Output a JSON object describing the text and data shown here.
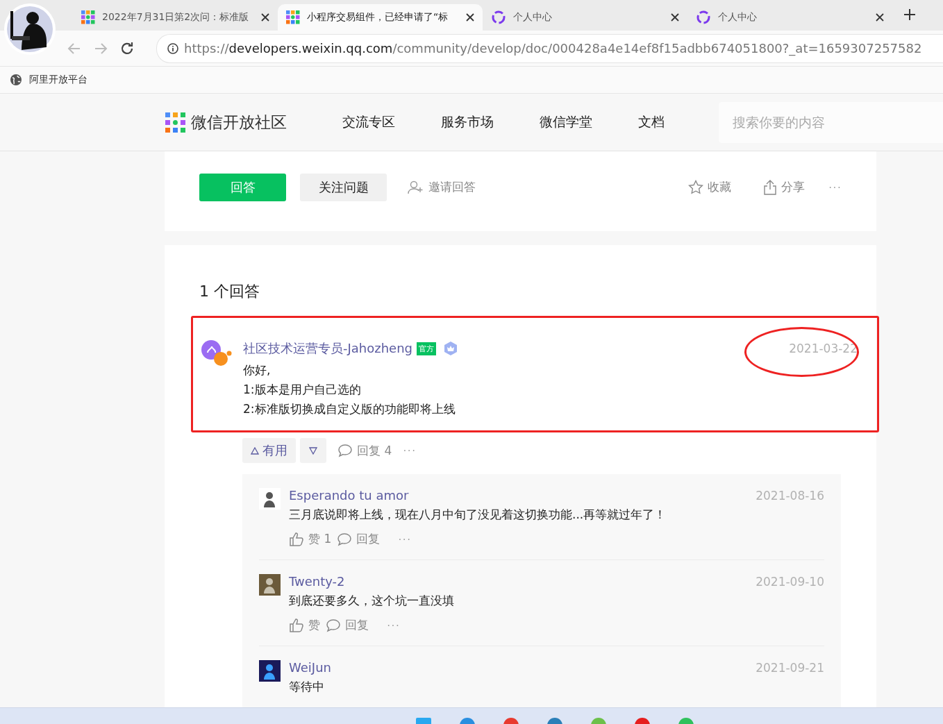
{
  "browser": {
    "tabs": [
      {
        "kind": "grid",
        "title": "2022年7月31日第2次问：标准版",
        "selected": false
      },
      {
        "kind": "grid",
        "title": "小程序交易组件，已经申请了“标",
        "selected": true
      },
      {
        "kind": "ring",
        "title": "个人中心",
        "selected": false
      },
      {
        "kind": "ring",
        "title": "个人中心",
        "selected": false
      }
    ],
    "url": {
      "scheme": "https://",
      "host": "developers.weixin.qq.com",
      "path": "/community/develop/doc/000428a4e14ef8f15adbb674051800?_at=1659307257582"
    },
    "bookmarks": [
      "阿里开放平台"
    ]
  },
  "site": {
    "logo": "微信开放社区",
    "nav": [
      "交流专区",
      "服务市场",
      "微信学堂",
      "文档"
    ],
    "search": {
      "placeholder": "搜索你要的内容"
    }
  },
  "question_actions": {
    "answer": "回答",
    "follow": "关注问题",
    "invite": "邀请回答",
    "favorite": "收藏",
    "share": "分享",
    "more": "···"
  },
  "answers_heading": "1 个回答",
  "answer": {
    "author": "社区技术运营专员-Jahozheng",
    "badge": "官方",
    "date": "2021-03-22",
    "lines": [
      "你好,",
      "1:版本是用户自己选的",
      "2:标准版切换成自定义版的功能即将上线"
    ],
    "highlight_box": true,
    "date_circled": true,
    "useful": "有用",
    "reply": "回复 4",
    "more": "···",
    "replies": [
      {
        "author": "Esperando tu amor",
        "date": "2021-08-16",
        "text": "三月底说即将上线，现在八月中旬了没见着这切换功能...再等就过年了！",
        "like": "赞 1",
        "reply": "回复",
        "more": "···"
      },
      {
        "author": "Twenty-2",
        "date": "2021-09-10",
        "text": "到底还要多久，这个坑一直没填",
        "like": "赞",
        "reply": "回复",
        "more": "···"
      },
      {
        "author": "WeiJun",
        "date": "2021-09-21",
        "text": "等待中"
      }
    ]
  }
}
